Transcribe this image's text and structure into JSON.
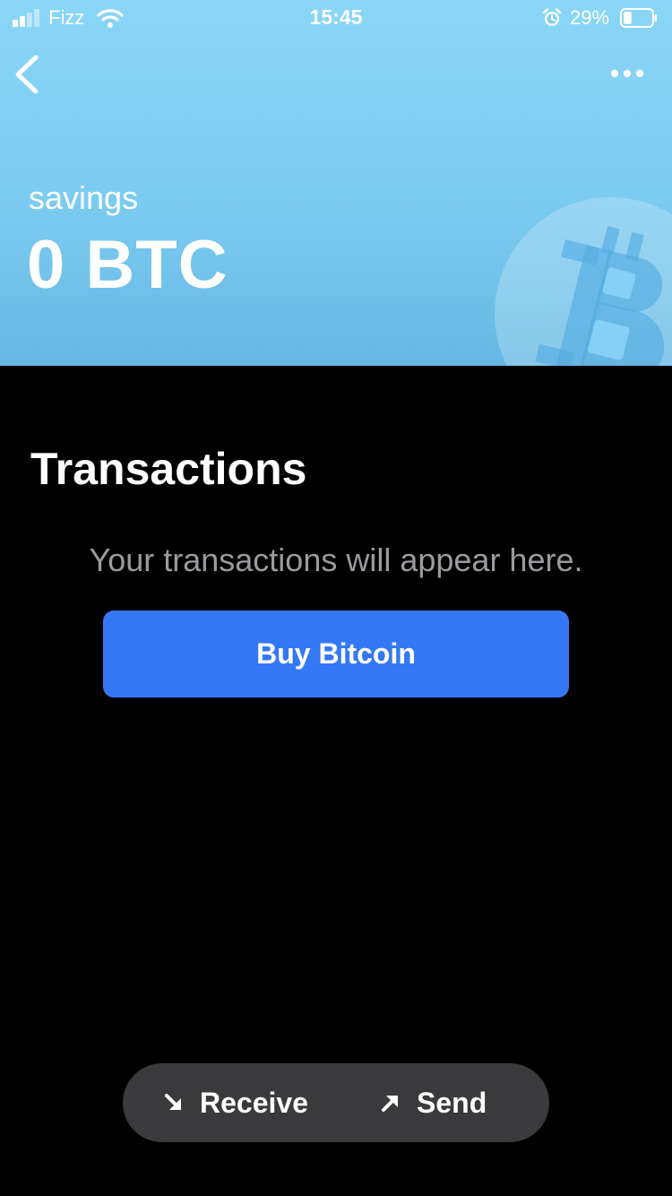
{
  "status_bar": {
    "carrier": "Fizz",
    "time": "15:45",
    "battery_percent": "29%",
    "battery_level": 0.29,
    "signal_bars_active": 2,
    "signal_bars_total": 4
  },
  "header": {
    "account_name": "savings",
    "balance": "0 BTC",
    "colors": {
      "gradient_top": "#8ad6f7",
      "gradient_bottom": "#66b8e3"
    }
  },
  "transactions": {
    "title": "Transactions",
    "empty_message": "Your transactions will appear here.",
    "buy_button_label": "Buy Bitcoin"
  },
  "actions": {
    "receive_label": "Receive",
    "send_label": "Send"
  },
  "icons": [
    "signal-icon",
    "wifi-icon",
    "alarm-icon",
    "battery-icon",
    "back-chevron-icon",
    "more-dots-icon",
    "bitcoin-logo-icon",
    "arrow-down-right-icon",
    "arrow-up-right-icon"
  ],
  "colors": {
    "accent": "#3478f6",
    "pill_background": "#3a3a3c",
    "muted_text": "#9a9a9f"
  }
}
